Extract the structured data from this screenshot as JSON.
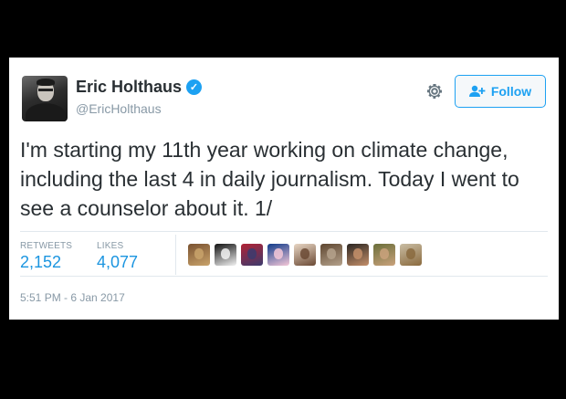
{
  "user": {
    "name": "Eric Holthaus",
    "handle": "@EricHolthaus",
    "verified_icon": "✓"
  },
  "actions": {
    "follow_label": "Follow"
  },
  "tweet": {
    "text": "I'm starting my 11th year working on climate change, including the last 4 in daily journalism. Today I went to see a counselor about it. 1/",
    "timestamp": "5:51 PM - 6 Jan 2017"
  },
  "stats": {
    "retweets_label": "RETWEETS",
    "retweets_count": "2,152",
    "likes_label": "LIKES",
    "likes_count": "4,077"
  },
  "likers": [
    {
      "colors": [
        "#7a5230",
        "#c9a36b"
      ]
    },
    {
      "colors": [
        "#111111",
        "#f2f2f2"
      ]
    },
    {
      "colors": [
        "#b22234",
        "#3c3b6e"
      ]
    },
    {
      "colors": [
        "#0f3a8a",
        "#f5c8d8"
      ]
    },
    {
      "colors": [
        "#e8d6c4",
        "#6b4a35"
      ]
    },
    {
      "colors": [
        "#5e4630",
        "#b5a28c"
      ]
    },
    {
      "colors": [
        "#2b2622",
        "#c48f6a"
      ]
    },
    {
      "colors": [
        "#6a6e3a",
        "#caa27c"
      ]
    },
    {
      "colors": [
        "#c9bda4",
        "#8a6a3e"
      ]
    }
  ],
  "theme": {
    "accent": "#1da1f2",
    "link": "#1b95e0",
    "text": "#292f33",
    "muted": "#8899a6"
  }
}
